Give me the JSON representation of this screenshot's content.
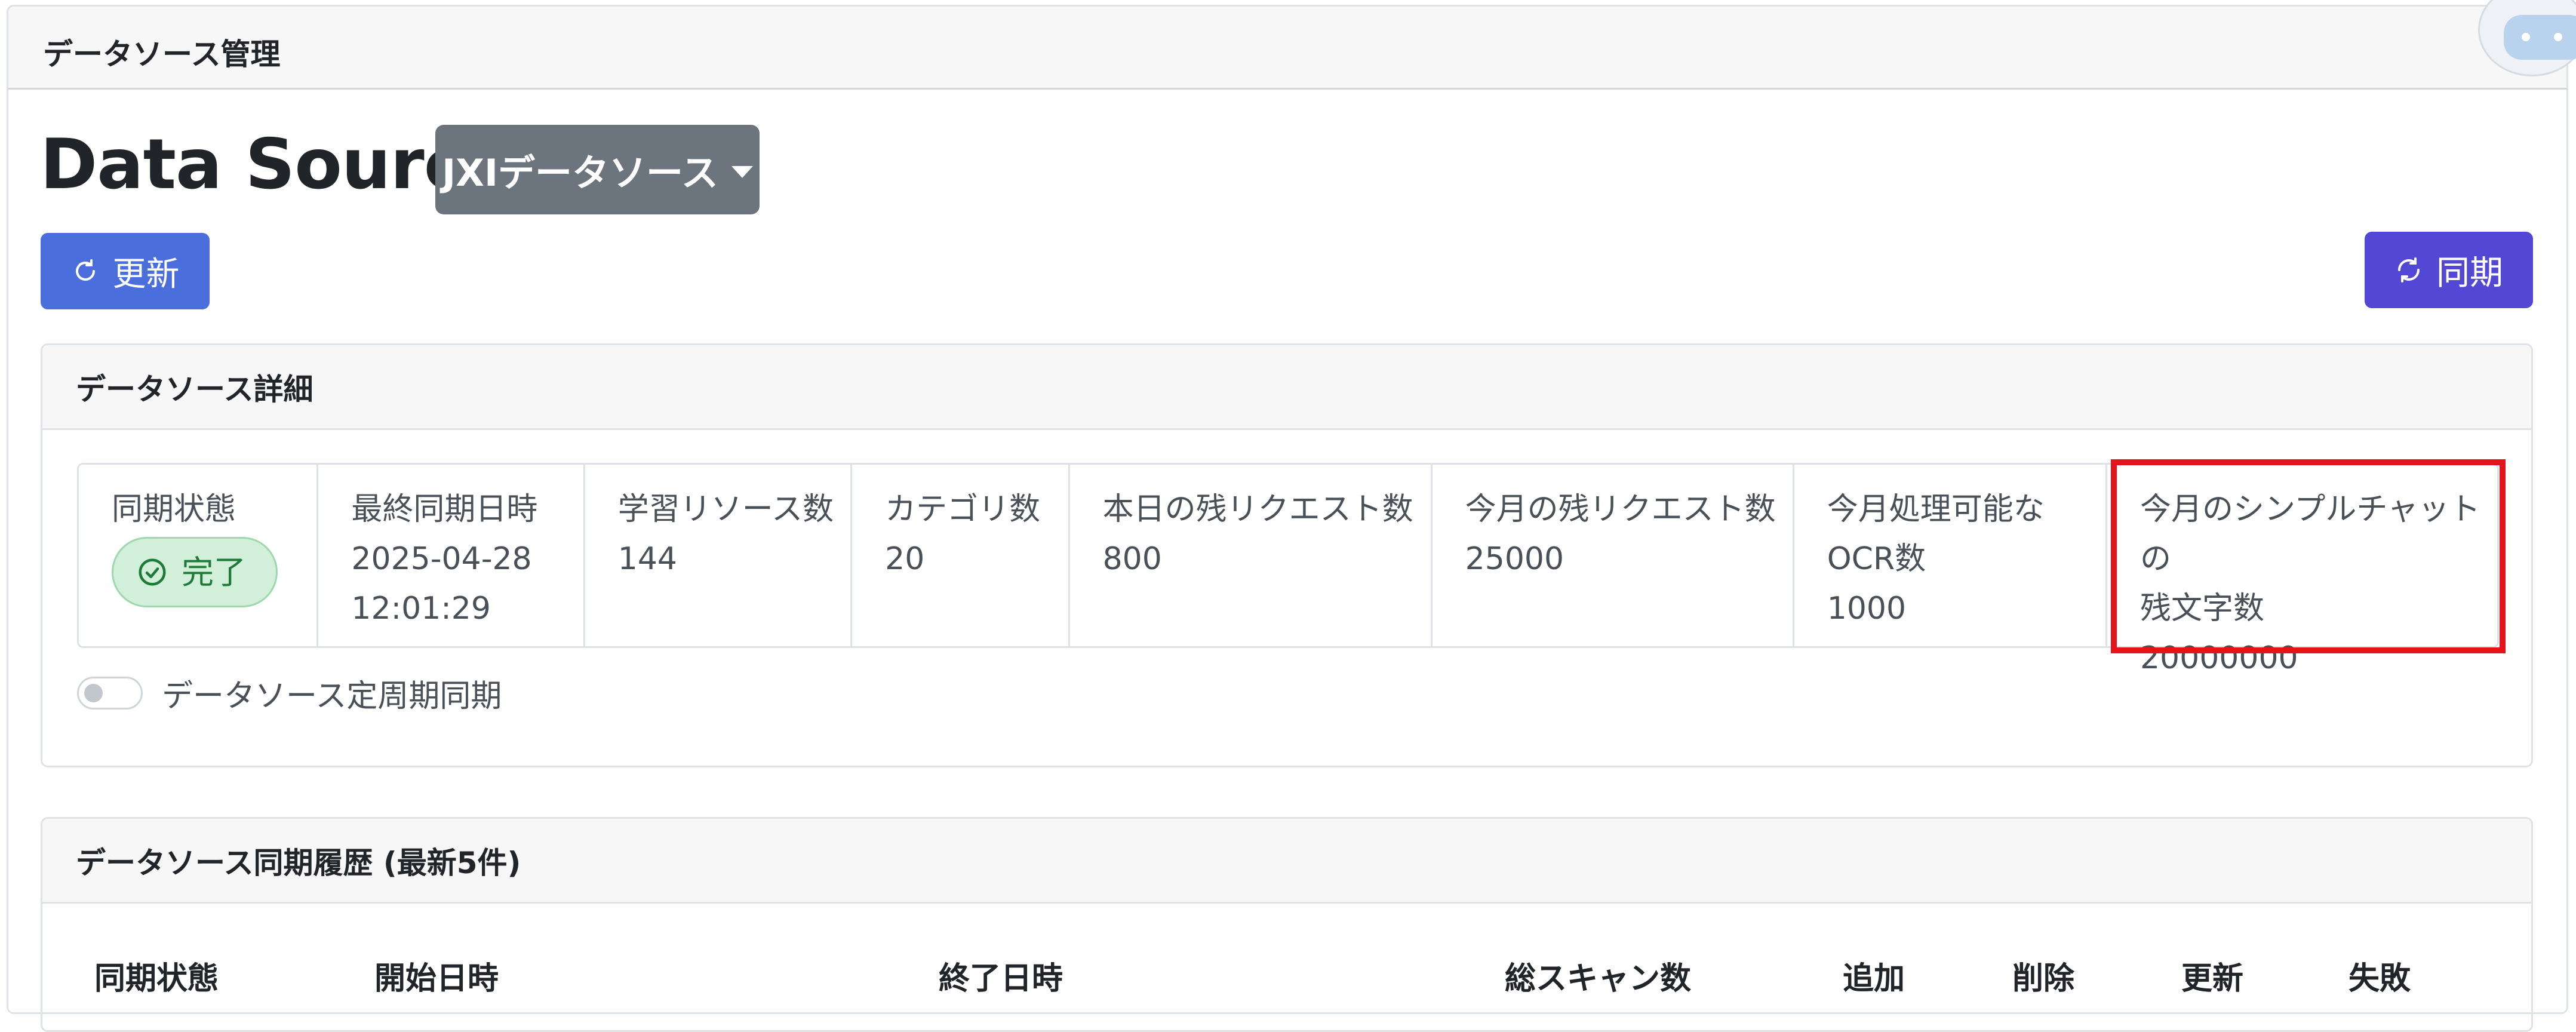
{
  "header": {
    "title": "データソース管理"
  },
  "datasource": {
    "label": "Data Source:",
    "selected": "JXIデータソース"
  },
  "toolbar": {
    "refresh_label": "更新",
    "sync_label": "同期"
  },
  "detail": {
    "title": "データソース詳細",
    "stats": [
      {
        "label": "同期状態",
        "badge": "完了"
      },
      {
        "label": "最終同期日時",
        "value_line1": "2025-04-28",
        "value_line2": "12:01:29"
      },
      {
        "label": "学習リソース数",
        "value": "144"
      },
      {
        "label": "カテゴリ数",
        "value": "20"
      },
      {
        "label": "本日の残リクエスト数",
        "value": "800"
      },
      {
        "label": "今月の残リクエスト数",
        "value": "25000"
      },
      {
        "label_line1": "今月処理可能な",
        "label_line2": "OCR数",
        "value": "1000"
      },
      {
        "label_line1": "今月のシンプルチャットの",
        "label_line2": "残文字数",
        "value": "20000000"
      }
    ],
    "toggle_label": "データソース定周期同期",
    "toggle_on": false
  },
  "history": {
    "title": "データソース同期履歴 (最新5件)",
    "columns": [
      "同期状態",
      "開始日時",
      "終了日時",
      "総スキャン数",
      "追加",
      "削除",
      "更新",
      "失敗"
    ]
  },
  "colors": {
    "refresh_button": "#4a6fdc",
    "sync_button": "#5348d6",
    "dropdown": "#6c757d",
    "status_success": "#d1efd9",
    "highlight": "#e5141c"
  }
}
